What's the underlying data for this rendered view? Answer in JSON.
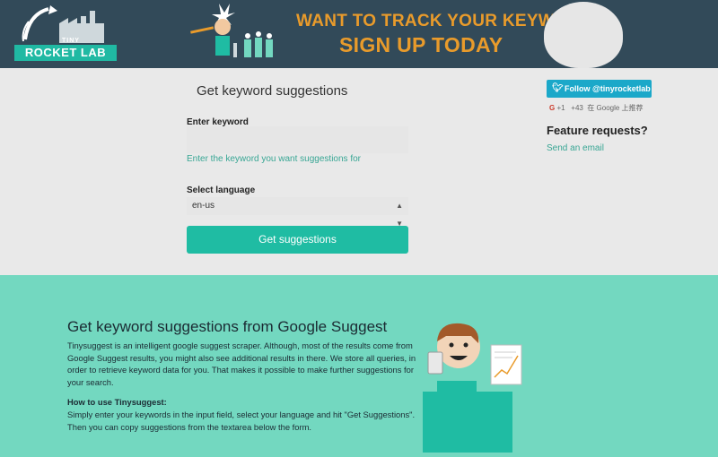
{
  "header": {
    "logo_small": "TINY",
    "logo_main": "ROCKET LAB",
    "promo_line1": "WANT TO TRACK YOUR KEYWORDS?",
    "promo_line2": "SIGN UP TODAY"
  },
  "form": {
    "title": "Get keyword suggestions",
    "keyword_label": "Enter keyword",
    "keyword_value": "",
    "keyword_help": "Enter the keyword you want suggestions for",
    "language_label": "Select language",
    "language_value": "en-us",
    "submit_label": "Get suggestions"
  },
  "sidebar": {
    "follow_label": "Follow @tinyrocketlab",
    "gplus_label": "+1",
    "gplus_count": "+43",
    "gplus_text": "在 Google 上推荐",
    "feature_title": "Feature requests?",
    "email_link": "Send an email"
  },
  "info": {
    "title": "Get keyword suggestions from Google Suggest",
    "paragraph": "Tinysuggest is an intelligent google suggest scraper. Although, most of the results come from Google Suggest results, you might also see additional results in there. We store all queries, in order to retrieve keyword data for you. That makes it possible to make further suggestions for your search.",
    "how_title": "How to use Tinysuggest:",
    "how_text": "Simply enter your keywords in the input field, select your language and hit \"Get Suggestions\". Then you can copy suggestions from the textarea below the form."
  },
  "colors": {
    "header_bg": "#324a59",
    "accent": "#1fbca3",
    "teal_section": "#73d8c0",
    "promo_orange": "#e99b2b",
    "twitter_blue": "#1ba8c9"
  }
}
